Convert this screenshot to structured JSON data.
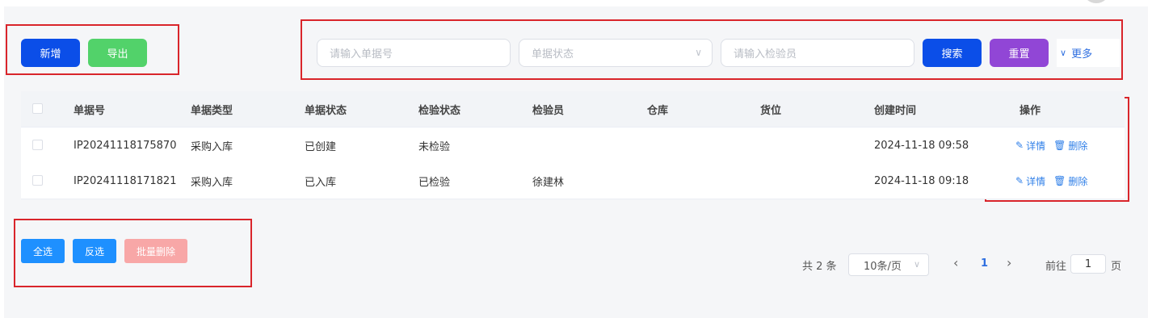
{
  "toolbar": {
    "add_label": "新增",
    "export_label": "导出"
  },
  "search": {
    "doc_no_placeholder": "请输入单据号",
    "status_placeholder": "单据状态",
    "inspector_placeholder": "请输入检验员",
    "search_label": "搜索",
    "reset_label": "重置",
    "more_label": "更多"
  },
  "table": {
    "headers": [
      "单据号",
      "单据类型",
      "单据状态",
      "检验状态",
      "检验员",
      "仓库",
      "货位",
      "创建时间",
      "操作"
    ],
    "rows": [
      {
        "doc_no": "IP20241118175870",
        "type": "采购入库",
        "status": "已创建",
        "inspection": "未检验",
        "inspector": "",
        "warehouse": "",
        "location": "",
        "created": "2024-11-18 09:58"
      },
      {
        "doc_no": "IP20241118171821",
        "type": "采购入库",
        "status": "已入库",
        "inspection": "已检验",
        "inspector": "徐建林",
        "warehouse": "",
        "location": "",
        "created": "2024-11-18 09:18"
      }
    ],
    "detail_label": "详情",
    "delete_label": "删除"
  },
  "bulk": {
    "select_all": "全选",
    "invert": "反选",
    "batch_delete": "批量删除"
  },
  "pagination": {
    "total_text": "共 2 条",
    "page_size": "10条/页",
    "current_page": "1",
    "goto_prefix": "前往",
    "goto_value": "1",
    "goto_suffix": "页"
  },
  "colors": {
    "primary": "#0b4ee8",
    "success": "#52d26a",
    "purple": "#9146d6",
    "blue": "#1e90ff",
    "danger_light": "#f8a7a7",
    "highlight_box": "#d9252b"
  }
}
